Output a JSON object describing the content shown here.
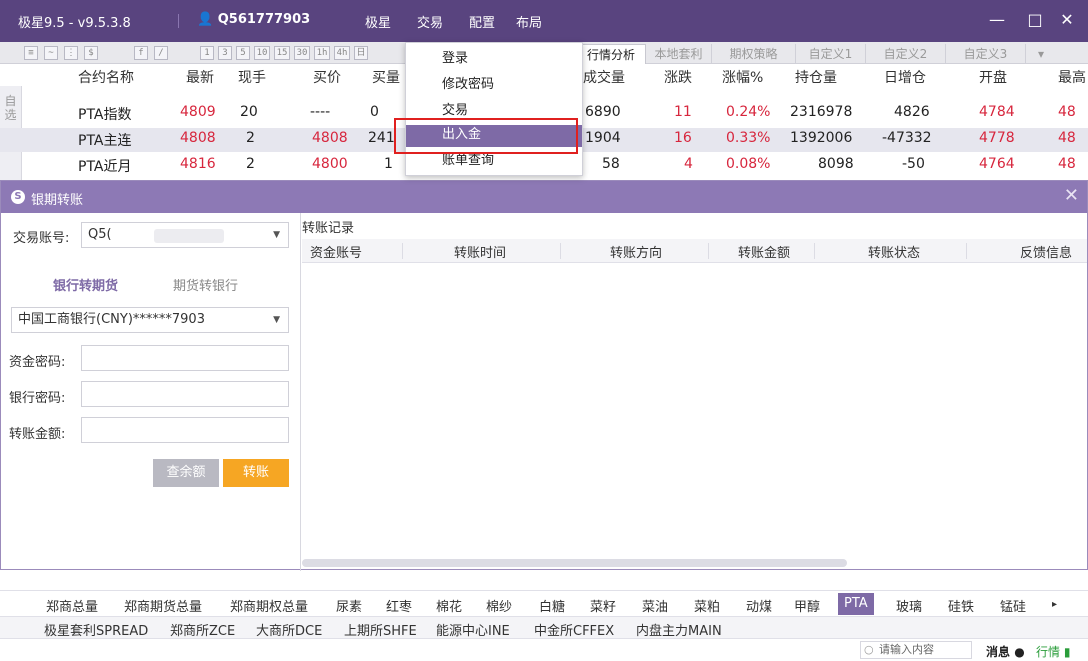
{
  "titlebar": {
    "app_title": "极星9.5 - v9.5.3.8",
    "account": "Q561777903",
    "menu": [
      "极星",
      "交易",
      "配置",
      "布局"
    ],
    "controls": [
      "—",
      "□",
      "✕"
    ]
  },
  "toolbar": {
    "icons": [
      "list-icon",
      "chart-icon",
      "chart-split-icon",
      "dollar-icon",
      "formula-icon",
      "draw-icon"
    ],
    "periods": [
      "1",
      "3",
      "5",
      "10",
      "15",
      "30",
      "1h",
      "4h",
      "日"
    ]
  },
  "tabs": [
    "行情分析",
    "本地套利",
    "期权策略",
    "自定义1",
    "自定义2",
    "自定义3",
    "▾"
  ],
  "quote_table": {
    "headers": [
      "合约名称",
      "最新",
      "现手",
      "买价",
      "买量",
      "成交量",
      "涨跌",
      "涨幅%",
      "持仓量",
      "日增仓",
      "开盘",
      "最高"
    ],
    "rows": [
      {
        "name": "PTA指数",
        "last": "4809",
        "vol": "20",
        "bid": "----",
        "bidqty": "0",
        "volume": "6890",
        "chg": "11",
        "pct": "0.24%",
        "oi": "2316978",
        "inc": "4826",
        "open": "4784",
        "high": "48"
      },
      {
        "name": "PTA主连",
        "last": "4808",
        "vol": "2",
        "bid": "4808",
        "bidqty": "241",
        "volume": "1904",
        "chg": "16",
        "pct": "0.33%",
        "oi": "1392006",
        "inc": "-47332",
        "open": "4778",
        "high": "48"
      },
      {
        "name": "PTA近月",
        "last": "4816",
        "vol": "2",
        "bid": "4800",
        "bidqty": "1",
        "volume": "58",
        "chg": "4",
        "pct": "0.08%",
        "oi": "8098",
        "inc": "-50",
        "open": "4764",
        "high": "48"
      }
    ],
    "side_tab": "自选"
  },
  "dropdown": {
    "items": [
      "登录",
      "修改密码",
      "交易",
      "出入金",
      "账单查询"
    ],
    "highlighted": "出入金"
  },
  "dialog": {
    "title": "银期转账",
    "account_label": "交易账号:",
    "account_value": "Q5(",
    "subtabs": [
      "银行转期货",
      "期货转银行"
    ],
    "bank": "中国工商银行(CNY)******7903",
    "fund_password_label": "资金密码:",
    "bank_password_label": "银行密码:",
    "amount_label": "转账金额:",
    "query_button": "查余额",
    "transfer_button": "转账",
    "record_title": "转账记录",
    "record_headers": [
      "资金账号",
      "转账时间",
      "转账方向",
      "转账金额",
      "转账状态",
      "反馈信息"
    ]
  },
  "bottom_tabs_1": [
    "郑商总量",
    "郑商期货总量",
    "郑商期权总量",
    "尿素",
    "红枣",
    "棉花",
    "棉纱",
    "白糖",
    "菜籽",
    "菜油",
    "菜粕",
    "动煤",
    "甲醇",
    "PTA",
    "玻璃",
    "硅铁",
    "锰硅",
    "▸"
  ],
  "bottom_active": "PTA",
  "bottom_tabs_2": [
    "极星套利SPREAD",
    "郑商所ZCE",
    "大商所DCE",
    "上期所SHFE",
    "能源中心INE",
    "中金所CFFEX",
    "内盘主力MAIN"
  ],
  "statusbar": {
    "search_placeholder": "请输入内容",
    "message": "消息",
    "quote": "行情"
  },
  "colors": {
    "title": "#59447f",
    "accent": "#7e6aa6",
    "red": "#d7263d",
    "orange": "#f6a623"
  }
}
